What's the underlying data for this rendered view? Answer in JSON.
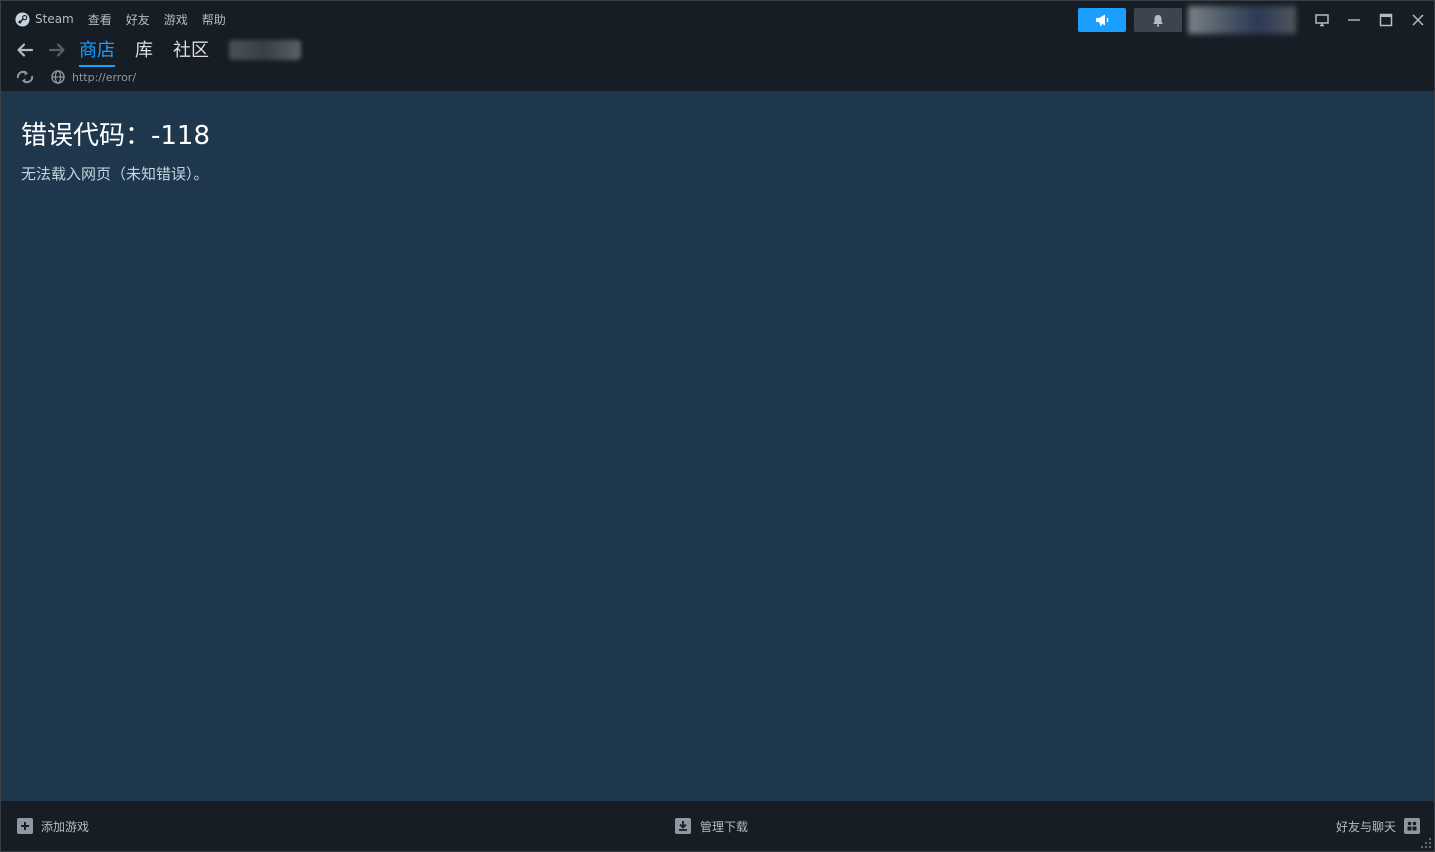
{
  "menubar": {
    "items": [
      "Steam",
      "查看",
      "好友",
      "游戏",
      "帮助"
    ]
  },
  "nav": {
    "tabs": [
      "商店",
      "库",
      "社区"
    ]
  },
  "url": {
    "address": "http://error/"
  },
  "error": {
    "title": "错误代码：-118",
    "message": "无法载入网页（未知错误）。"
  },
  "bottombar": {
    "add_game": "添加游戏",
    "manage_downloads": "管理下载",
    "friends_chat": "好友与聊天"
  },
  "colors": {
    "accent": "#1a9fff",
    "content_bg": "#1e374d",
    "chrome_bg": "#171d25"
  },
  "icons": {
    "steam": "steam-logo-icon",
    "back": "arrow-left-icon",
    "forward": "arrow-right-icon",
    "reload": "reload-icon",
    "globe": "globe-icon",
    "announce": "megaphone-icon",
    "notify": "bell-icon",
    "big_picture": "monitor-icon",
    "minimize": "minimize-icon",
    "maximize": "maximize-icon",
    "close": "close-icon",
    "add": "plus-icon",
    "download": "download-icon",
    "friends": "friends-icon"
  }
}
